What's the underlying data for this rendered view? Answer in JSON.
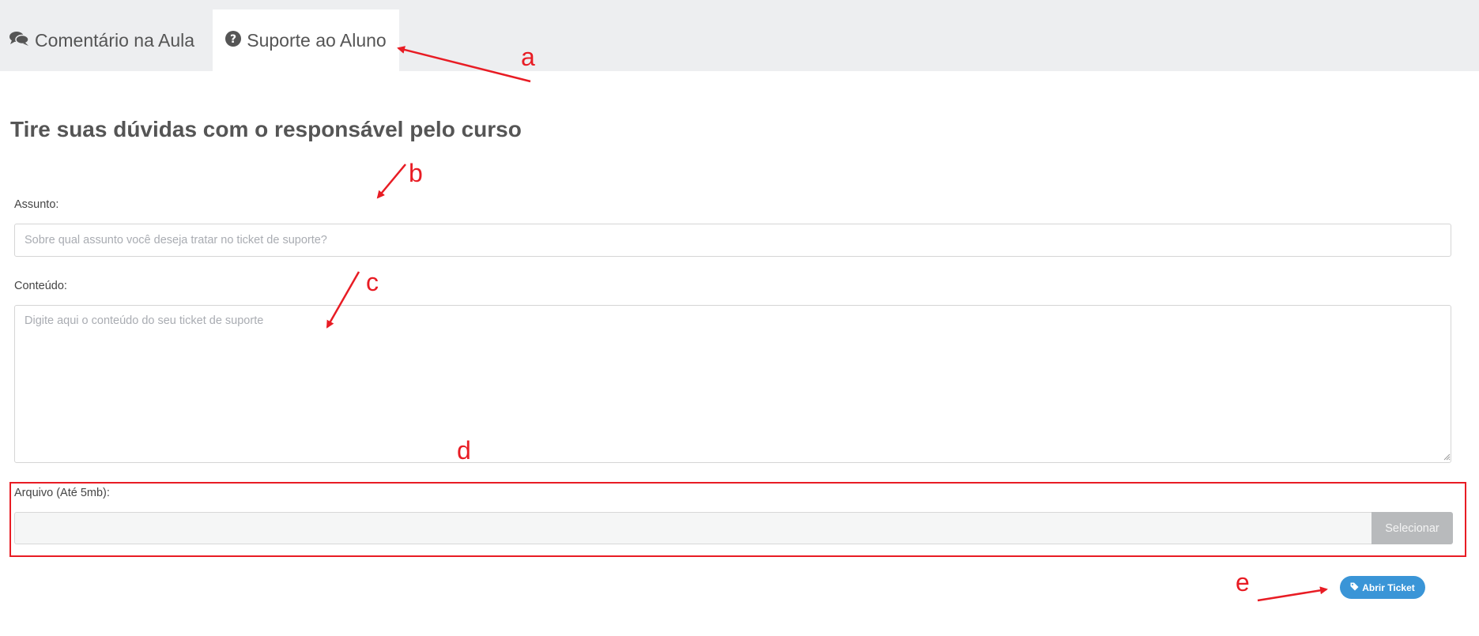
{
  "tabs": {
    "comment": {
      "label": "Comentário na Aula",
      "icon": "comments-icon"
    },
    "support": {
      "label": "Suporte ao Aluno",
      "icon": "question-circle-icon",
      "active": true
    }
  },
  "page": {
    "title": "Tire suas dúvidas com o responsável pelo curso"
  },
  "form": {
    "subject_label": "Assunto:",
    "subject_placeholder": "Sobre qual assunto você deseja tratar no ticket de suporte?",
    "subject_value": "",
    "content_label": "Conteúdo:",
    "content_placeholder": "Digite aqui o conteúdo do seu ticket de suporte",
    "content_value": "",
    "file_label": "Arquivo (Até 5mb):",
    "file_value": "",
    "file_button": "Selecionar",
    "submit_label": "Abrir Ticket",
    "submit_icon": "tag-icon"
  },
  "annotations": {
    "a": "a",
    "b": "b",
    "c": "c",
    "d": "d",
    "e": "e",
    "color": "#e81c24"
  },
  "colors": {
    "tabbar": "#edeef0",
    "accent": "#3a95d7",
    "file_button": "#b8babc",
    "annotation": "#e81c24"
  }
}
